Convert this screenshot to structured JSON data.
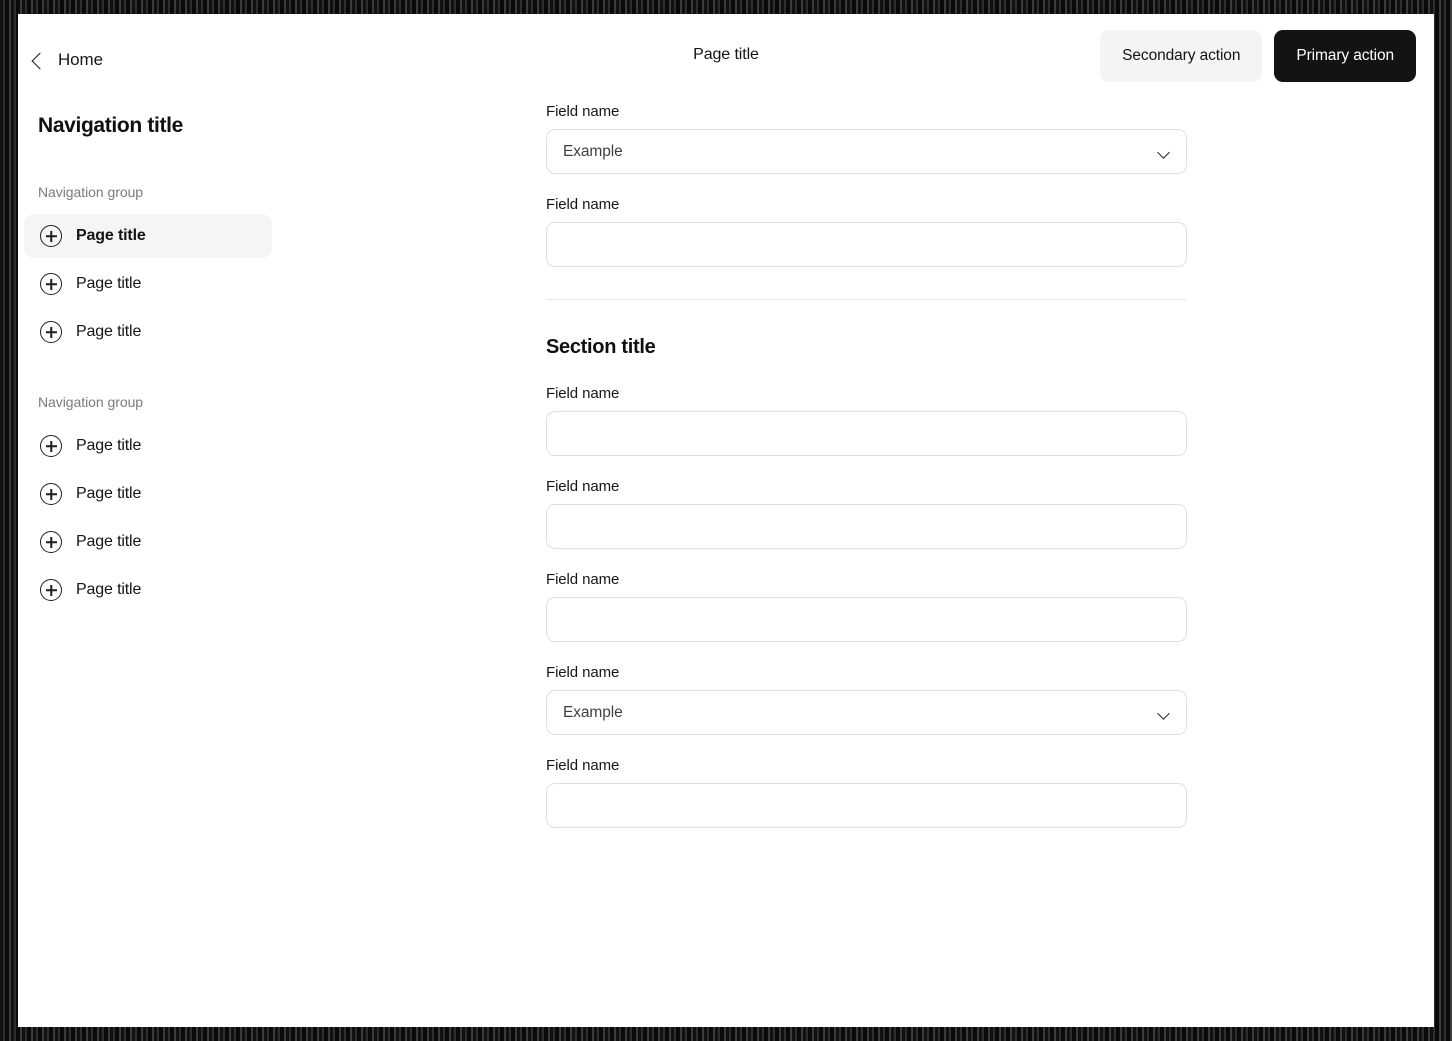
{
  "header": {
    "back_label": "Home",
    "back_icon": "chevron-left-icon",
    "page_title": "Page title",
    "secondary_action": "Secondary action",
    "primary_action": "Primary action",
    "primary_bg": "#131313",
    "secondary_bg": "#f4f4f4"
  },
  "sidebar": {
    "title": "Navigation title",
    "groups": [
      {
        "label": "Navigation group",
        "items": [
          {
            "label": "Page title",
            "icon": "plus-circle-icon",
            "active": true
          },
          {
            "label": "Page title",
            "icon": "plus-circle-icon",
            "active": false
          },
          {
            "label": "Page title",
            "icon": "plus-circle-icon",
            "active": false
          }
        ]
      },
      {
        "label": "Navigation group",
        "items": [
          {
            "label": "Page title",
            "icon": "plus-circle-icon",
            "active": false
          },
          {
            "label": "Page title",
            "icon": "plus-circle-icon",
            "active": false
          },
          {
            "label": "Page title",
            "icon": "plus-circle-icon",
            "active": false
          },
          {
            "label": "Page title",
            "icon": "plus-circle-icon",
            "active": false
          }
        ]
      }
    ]
  },
  "main": {
    "section_one": {
      "fields": [
        {
          "label": "",
          "type": "text",
          "value": "",
          "clipped": true
        },
        {
          "label": "Field name",
          "type": "select",
          "value": "Example"
        },
        {
          "label": "Field name",
          "type": "text",
          "value": ""
        }
      ]
    },
    "section_two": {
      "title": "Section title",
      "fields": [
        {
          "label": "Field name",
          "type": "text",
          "value": ""
        },
        {
          "label": "Field name",
          "type": "text",
          "value": ""
        },
        {
          "label": "Field name",
          "type": "text",
          "value": ""
        },
        {
          "label": "Field name",
          "type": "select",
          "value": "Example"
        },
        {
          "label": "Field name",
          "type": "text",
          "value": ""
        }
      ]
    }
  }
}
